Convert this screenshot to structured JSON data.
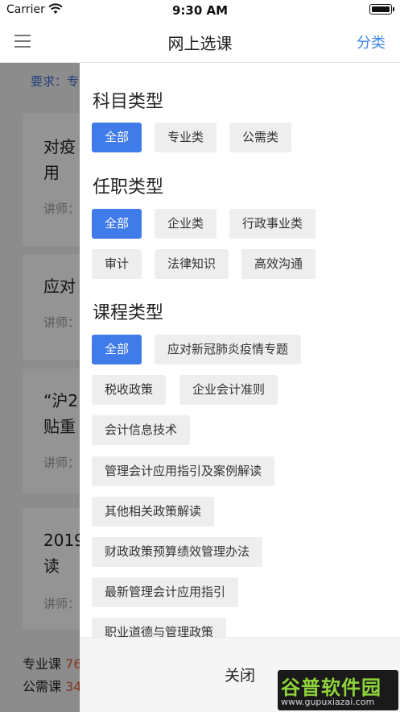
{
  "status_bar": {
    "carrier": "Carrier",
    "time": "9:30 AM"
  },
  "nav": {
    "title": "网上选课",
    "right_label": "分类"
  },
  "background_list": {
    "requirement": "要求：专",
    "cards": [
      {
        "title": "对疫\n用",
        "lecturer": "讲师："
      },
      {
        "title": "应对",
        "lecturer": "讲师："
      },
      {
        "title": "“沪2\n贴重",
        "lecturer": "讲师："
      },
      {
        "title": "2019\n读",
        "lecturer": "讲师："
      }
    ],
    "footer": [
      {
        "label": "专业课",
        "value": "76"
      },
      {
        "label": "公需课",
        "value": "34"
      }
    ]
  },
  "filter": {
    "subject_type": {
      "title": "科目类型",
      "options": [
        "全部",
        "专业类",
        "公需类"
      ],
      "selected": "全部"
    },
    "position_type": {
      "title": "任职类型",
      "options": [
        "全部",
        "企业类",
        "行政事业类",
        "审计",
        "法律知识",
        "高效沟通"
      ],
      "selected": "全部"
    },
    "course_type": {
      "title": "课程类型",
      "options": [
        "全部",
        "应对新冠肺炎疫情专题",
        "税收政策",
        "企业会计准则",
        "会计信息技术",
        "管理会计应用指引及案例解读",
        "其他相关政策解读",
        "财政政策预算绩效管理办法",
        "最新管理会计应用指引",
        "职业道德与管理政策"
      ],
      "selected": "全部"
    },
    "close_label": "关闭"
  },
  "watermark": {
    "text": "谷普软件园",
    "url": "www.gupuxiazai.com"
  },
  "colors": {
    "accent": "#3f7be9",
    "link": "#3f86e8",
    "highlight": "#e05a3a"
  }
}
